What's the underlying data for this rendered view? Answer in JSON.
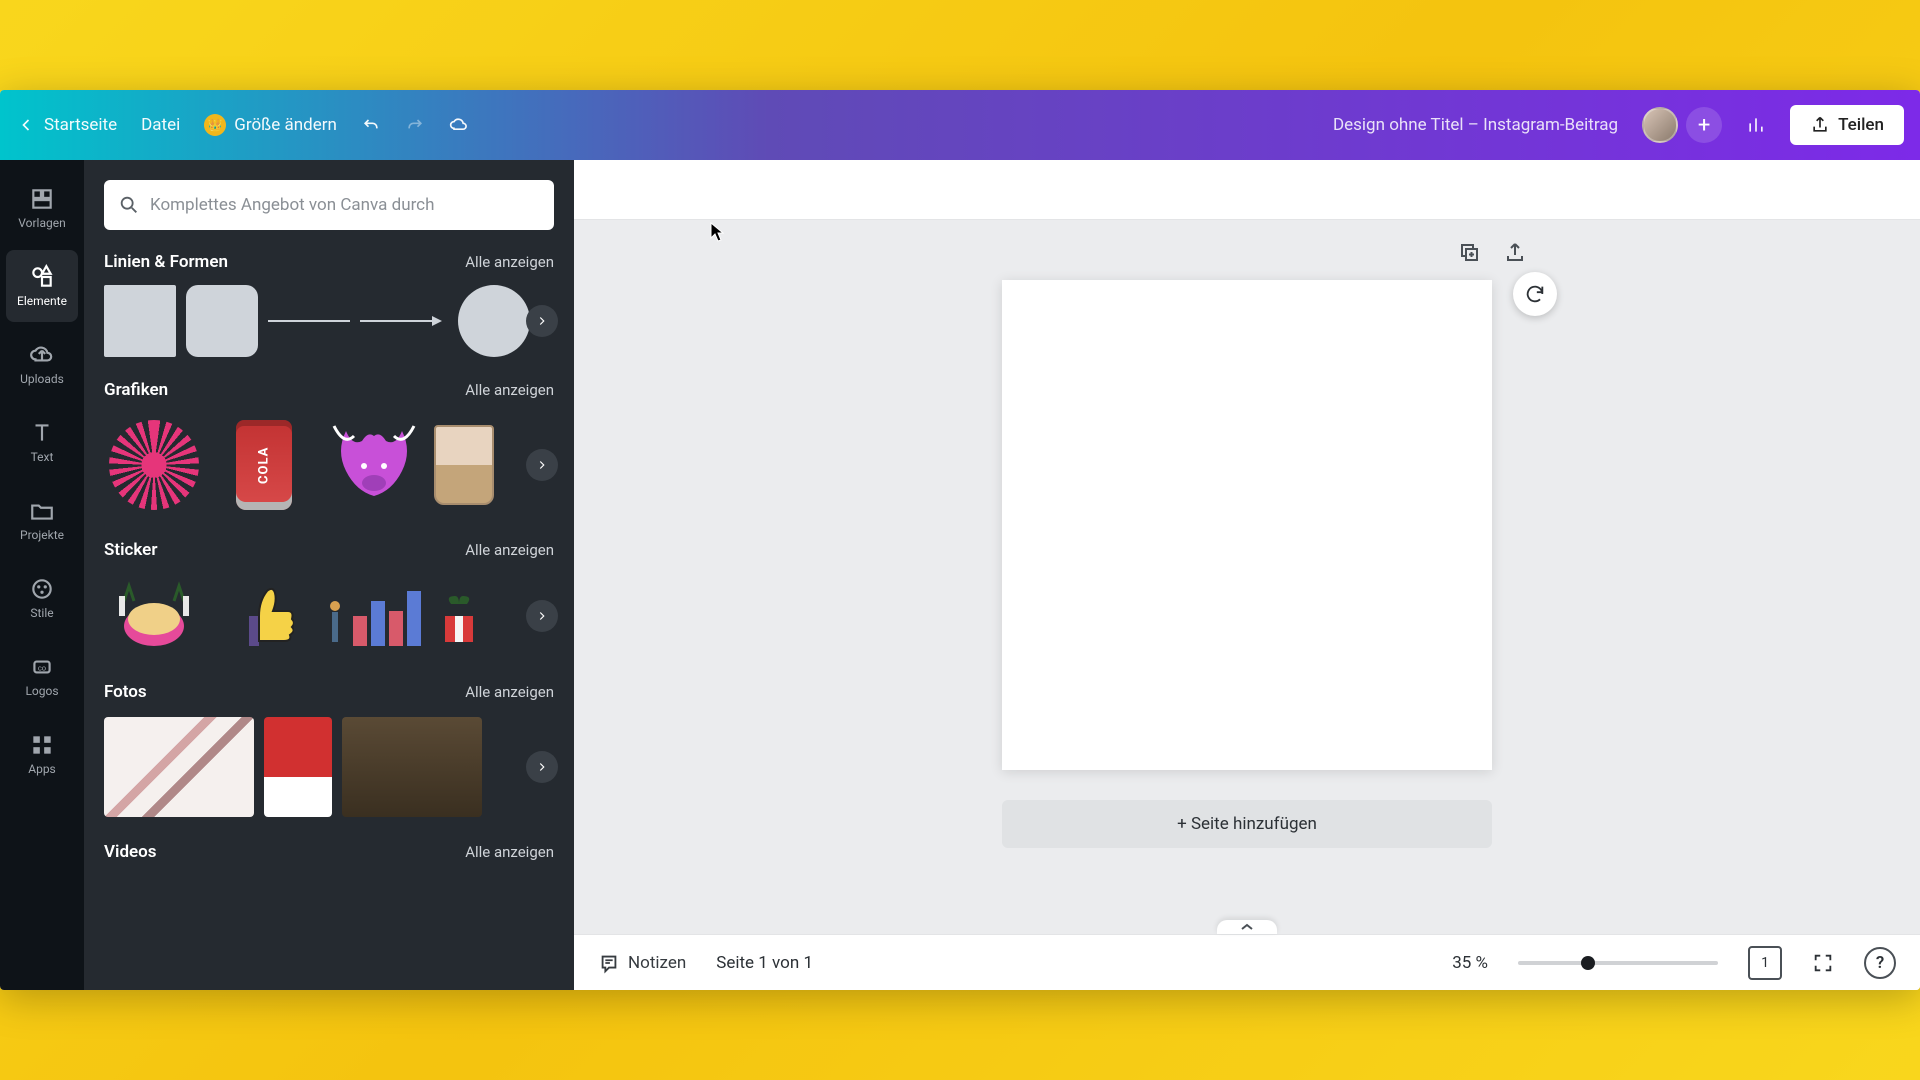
{
  "topbar": {
    "home_label": "Startseite",
    "file_label": "Datei",
    "resize_label": "Größe ändern",
    "title": "Design ohne Titel – Instagram-Beitrag",
    "share_label": "Teilen"
  },
  "nav": {
    "items": [
      {
        "label": "Vorlagen"
      },
      {
        "label": "Elemente"
      },
      {
        "label": "Uploads"
      },
      {
        "label": "Text"
      },
      {
        "label": "Projekte"
      },
      {
        "label": "Stile"
      },
      {
        "label": "Logos"
      },
      {
        "label": "Apps"
      }
    ],
    "active_index": 1
  },
  "search": {
    "placeholder": "Komplettes Angebot von Canva durch"
  },
  "categories": [
    {
      "title": "Linien & Formen",
      "all": "Alle anzeigen"
    },
    {
      "title": "Grafiken",
      "all": "Alle anzeigen"
    },
    {
      "title": "Sticker",
      "all": "Alle anzeigen"
    },
    {
      "title": "Fotos",
      "all": "Alle anzeigen"
    },
    {
      "title": "Videos",
      "all": "Alle anzeigen"
    }
  ],
  "graphics": {
    "cola_label": "COLA"
  },
  "canvas": {
    "add_page_label": "+ Seite hinzufügen"
  },
  "footer": {
    "notes_label": "Notizen",
    "page_indicator": "Seite 1 von 1",
    "zoom_label": "35 %",
    "page_count": "1",
    "help": "?"
  },
  "colors": {
    "accent_gradient_start": "#00c4cc",
    "accent_gradient_end": "#7d2ae8",
    "panel_bg": "#252a30"
  }
}
